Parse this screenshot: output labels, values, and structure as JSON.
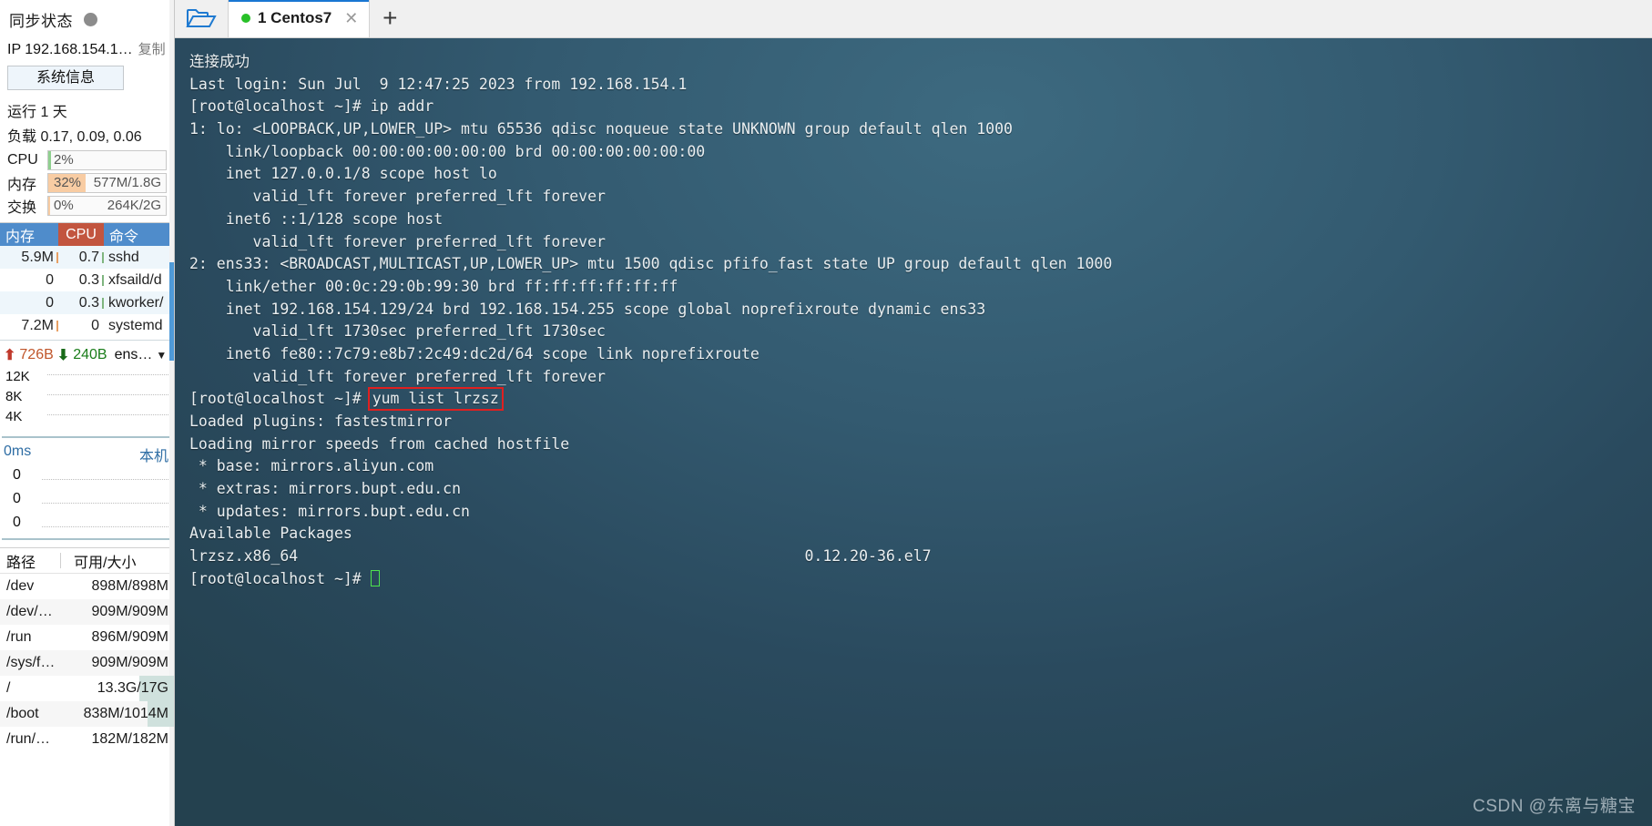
{
  "sidebar": {
    "sync": {
      "label": "同步状态",
      "status_icon": "status-dot-icon"
    },
    "ip": {
      "label": "IP 192.168.154.1…",
      "copy_label": "复制"
    },
    "system_info_button": "系统信息",
    "uptime": "运行 1 天",
    "load": "负载 0.17, 0.09, 0.06",
    "meters": [
      {
        "name": "CPU",
        "percent": "2%",
        "value": "",
        "fill_pct": 2,
        "color": "#8fd08f"
      },
      {
        "name": "内存",
        "percent": "32%",
        "value": "577M/1.8G",
        "fill_pct": 32,
        "color": "#f8cca3"
      },
      {
        "name": "交换",
        "percent": "0%",
        "value": "264K/2G",
        "fill_pct": 0,
        "color": "#f8cca3"
      }
    ],
    "processes": {
      "headers": {
        "mem": "内存",
        "cpu": "CPU",
        "cmd": "命令"
      },
      "rows": [
        {
          "mem": "5.9M",
          "cpu": "0.7",
          "cmd": "sshd",
          "mem_tick": true,
          "cpu_tick": true
        },
        {
          "mem": "0",
          "cpu": "0.3",
          "cmd": "xfsaild/d",
          "mem_tick": false,
          "cpu_tick": true
        },
        {
          "mem": "0",
          "cpu": "0.3",
          "cmd": "kworker/",
          "mem_tick": false,
          "cpu_tick": true
        },
        {
          "mem": "7.2M",
          "cpu": "0",
          "cmd": "systemd",
          "mem_tick": true,
          "cpu_tick": false
        }
      ]
    },
    "network": {
      "up_icon": "arrow-up-icon",
      "up_value": "726B",
      "down_icon": "arrow-down-icon",
      "down_value": "240B",
      "interface": "ens…",
      "dropdown_icon": "chevron-down-icon",
      "axis": [
        "12K",
        "8K",
        "4K"
      ]
    },
    "ping": {
      "scale": "0ms",
      "host": "本机",
      "axis": [
        "0",
        "0",
        "0"
      ]
    },
    "disks": {
      "headers": {
        "path": "路径",
        "size": "可用/大小"
      },
      "rows": [
        {
          "path": "/dev",
          "size": "898M/898M",
          "fill_pct": 0
        },
        {
          "path": "/dev/…",
          "size": "909M/909M",
          "fill_pct": 0
        },
        {
          "path": "/run",
          "size": "896M/909M",
          "fill_pct": 0
        },
        {
          "path": "/sys/f…",
          "size": "909M/909M",
          "fill_pct": 0
        },
        {
          "path": "/",
          "size": "13.3G/17G",
          "fill_pct": 20
        },
        {
          "path": "/boot",
          "size": "838M/1014M",
          "fill_pct": 15
        },
        {
          "path": "/run/…",
          "size": "182M/182M",
          "fill_pct": 0
        }
      ]
    }
  },
  "tabbar": {
    "folder_icon": "open-folder-icon",
    "tabs": [
      {
        "dot_icon": "connected-dot-icon",
        "label": "1 Centos7",
        "close_icon": "close-icon"
      }
    ],
    "add_icon": "plus-icon"
  },
  "terminal": {
    "highlight_color": "#e02020",
    "lines": [
      {
        "text": "连接成功"
      },
      {
        "text": "Last login: Sun Jul  9 12:47:25 2023 from 192.168.154.1"
      },
      {
        "text": "[root@localhost ~]# ip addr"
      },
      {
        "text": "1: lo: <LOOPBACK,UP,LOWER_UP> mtu 65536 qdisc noqueue state UNKNOWN group default qlen 1000"
      },
      {
        "text": "    link/loopback 00:00:00:00:00:00 brd 00:00:00:00:00:00"
      },
      {
        "text": "    inet 127.0.0.1/8 scope host lo"
      },
      {
        "text": "       valid_lft forever preferred_lft forever"
      },
      {
        "text": "    inet6 ::1/128 scope host"
      },
      {
        "text": "       valid_lft forever preferred_lft forever"
      },
      {
        "text": "2: ens33: <BROADCAST,MULTICAST,UP,LOWER_UP> mtu 1500 qdisc pfifo_fast state UP group default qlen 1000"
      },
      {
        "text": "    link/ether 00:0c:29:0b:99:30 brd ff:ff:ff:ff:ff:ff"
      },
      {
        "text": "    inet 192.168.154.129/24 brd 192.168.154.255 scope global noprefixroute dynamic ens33"
      },
      {
        "text": "       valid_lft 1730sec preferred_lft 1730sec"
      },
      {
        "text": "    inet6 fe80::7c79:e8b7:2c49:dc2d/64 scope link noprefixroute"
      },
      {
        "text": "       valid_lft forever preferred_lft forever"
      },
      {
        "prefix": "[root@localhost ~]# ",
        "highlight": "yum list lrzsz"
      },
      {
        "text": "Loaded plugins: fastestmirror"
      },
      {
        "text": "Loading mirror speeds from cached hostfile"
      },
      {
        "text": " * base: mirrors.aliyun.com"
      },
      {
        "text": " * extras: mirrors.bupt.edu.cn"
      },
      {
        "text": " * updates: mirrors.bupt.edu.cn"
      },
      {
        "text": "Available Packages"
      },
      {
        "text": "lrzsz.x86_64                                                        0.12.20-36.el7"
      },
      {
        "prefix": "[root@localhost ~]# ",
        "cursor": true
      }
    ],
    "watermark": "CSDN @东离与糖宝"
  }
}
